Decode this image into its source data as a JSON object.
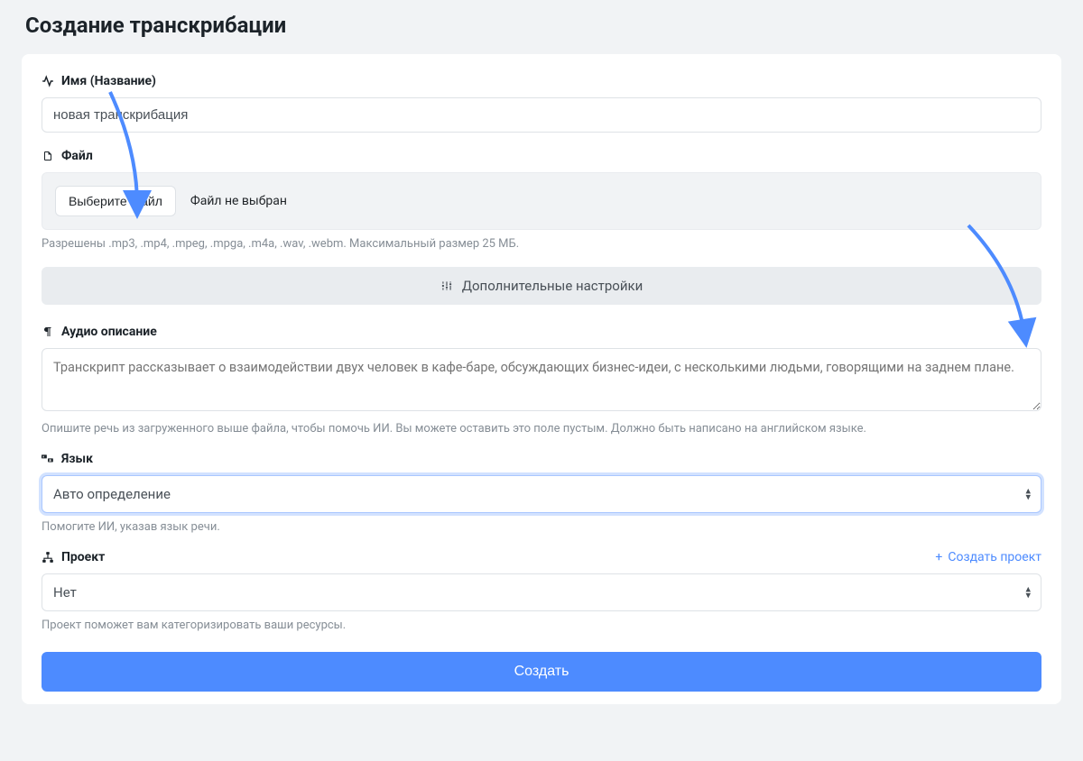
{
  "page": {
    "title": "Создание транскрибации"
  },
  "name_field": {
    "label": "Имя (Название)",
    "value": "новая транскрибация"
  },
  "file_field": {
    "label": "Файл",
    "choose_button": "Выберите файл",
    "no_file": "Файл не выбран",
    "hint": "Разрешены .mp3, .mp4, .mpeg, .mpga, .m4a, .wav, .webm. Максимальный размер 25 МБ."
  },
  "advanced": {
    "label": "Дополнительные настройки"
  },
  "audio_desc": {
    "label": "Аудио описание",
    "placeholder": "Транскрипт рассказывает о взаимодействии двух человек в кафе-баре, обсуждающих бизнес-идеи, с несколькими людьми, говорящими на заднем плане.",
    "hint": "Опишите речь из загруженного выше файла, чтобы помочь ИИ. Вы можете оставить это поле пустым. Должно быть написано на английском языке."
  },
  "language": {
    "label": "Язык",
    "selected": "Авто определение",
    "hint": "Помогите ИИ, указав язык речи."
  },
  "project": {
    "label": "Проект",
    "create_link": "Создать проект",
    "selected": "Нет",
    "hint": "Проект поможет вам категоризировать ваши ресурсы."
  },
  "submit": {
    "label": "Создать"
  }
}
